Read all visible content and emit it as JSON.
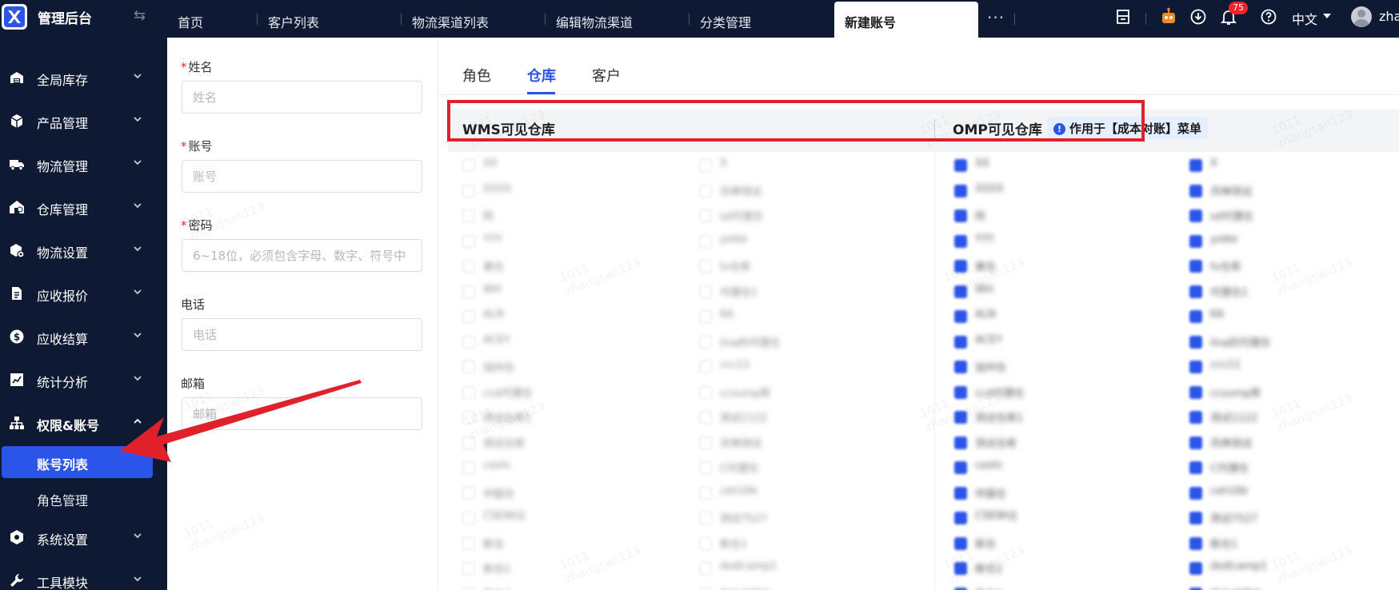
{
  "app": {
    "title": "管理后台",
    "collapse_icon": "double-arrow-icon"
  },
  "tabs": [
    {
      "label": "首页"
    },
    {
      "label": "客户列表"
    },
    {
      "label": "物流渠道列表"
    },
    {
      "label": "编辑物流渠道"
    },
    {
      "label": "分类管理"
    },
    {
      "label": "新建账号",
      "active": true
    }
  ],
  "topbar": {
    "more": "···",
    "notification_count": "75",
    "language": "中文",
    "username": "zhangsan"
  },
  "sidebar": {
    "items": [
      {
        "label": "全局库存",
        "icon": "warehouse-icon"
      },
      {
        "label": "产品管理",
        "icon": "box-icon"
      },
      {
        "label": "物流管理",
        "icon": "truck-icon"
      },
      {
        "label": "仓库管理",
        "icon": "store-icon"
      },
      {
        "label": "物流设置",
        "icon": "parcel-settings-icon"
      },
      {
        "label": "应收报价",
        "icon": "document-icon"
      },
      {
        "label": "应收结算",
        "icon": "dollar-coin-icon"
      },
      {
        "label": "统计分析",
        "icon": "chart-icon"
      },
      {
        "label": "权限&账号",
        "icon": "org-chart-icon",
        "open": true
      }
    ],
    "sub_items": [
      {
        "label": "账号列表",
        "active": true
      },
      {
        "label": "角色管理"
      }
    ],
    "items_after": [
      {
        "label": "系统设置",
        "icon": "hexagon-gear-icon"
      },
      {
        "label": "工具模块",
        "icon": "wrench-icon"
      }
    ]
  },
  "form": {
    "name": {
      "label": "姓名",
      "placeholder": "姓名",
      "required": true
    },
    "account": {
      "label": "账号",
      "placeholder": "账号",
      "required": true
    },
    "password": {
      "label": "密码",
      "placeholder": "6~18位，必须包含字母、数字、符号中",
      "required": true
    },
    "phone": {
      "label": "电话",
      "placeholder": "电话"
    },
    "email": {
      "label": "邮箱",
      "placeholder": "邮箱"
    }
  },
  "sub_tabs": [
    {
      "label": "角色"
    },
    {
      "label": "仓库",
      "active": true
    },
    {
      "label": "客户"
    }
  ],
  "warehouse": {
    "wms_title": "WMS可见仓库",
    "omp_title": "OMP可见仓库",
    "omp_note": "作用于【成本对账】菜单",
    "wms_col1": [
      "XX",
      "XXXX",
      "阿",
      "YYY",
      "美仓",
      "WH",
      "ALN",
      "ACEY",
      "加州仓",
      "ccd代理仓",
      "测试仓库1",
      "测试仓库",
      "ceshi",
      "中国仓",
      "CSEWUJ",
      "新仓",
      "新仓2",
      "新仓A"
    ],
    "wms_col2": [
      "X",
      "月神测试",
      "sd代理仓",
      "yoike",
      "fv仓库",
      "代理仓1",
      "KA",
      "lina的代理仓",
      "ccc11",
      "ccsump库",
      "测试1122",
      "月神测试",
      "C代理仓",
      "ceh16k",
      "测试7527",
      "新仓1",
      "dsdlcamp1",
      "新仓代理仓"
    ],
    "omp_col1": [
      "XX",
      "XXXX",
      "阿",
      "YYY",
      "美仓",
      "WH",
      "ALN",
      "ACEY",
      "加州仓",
      "ccd代理仓",
      "测试仓库1",
      "测试仓库",
      "ceshi",
      "中国仓",
      "CSEWUJ",
      "新仓",
      "新仓2",
      "新仓A"
    ],
    "omp_col2": [
      "X",
      "月神测试",
      "sd代理仓",
      "yoike",
      "fv仓库",
      "代理仓1",
      "KA",
      "lina的代理仓",
      "ccc11",
      "ccsump库",
      "测试1122",
      "月神测试",
      "C代理仓",
      "ceh16k",
      "测试7527",
      "新仓1",
      "dsdlcamp1",
      "新仓代理仓"
    ]
  },
  "watermark": {
    "line1": "1011",
    "line2": "zhangsan123"
  },
  "colors": {
    "primary": "#2b55e8",
    "sidebar_bg": "#0e1a33",
    "annotation_red": "#e0212b",
    "badge_red": "#f5222d"
  }
}
